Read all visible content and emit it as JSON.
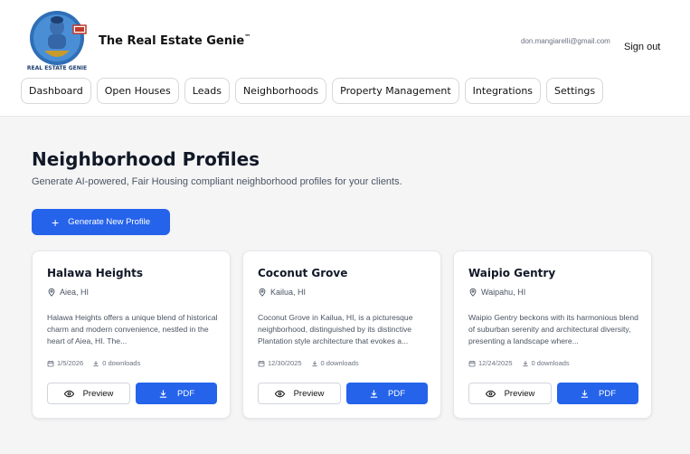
{
  "header": {
    "brand": "The Real Estate Genie",
    "brand_mark": "™",
    "logo_icon": "genie-logo-icon",
    "logo_text": "REAL ESTATE GENIE",
    "user_email": "don.mangiarelli@gmail.com",
    "sign_out": "Sign out"
  },
  "nav": [
    {
      "label": "Dashboard"
    },
    {
      "label": "Open Houses"
    },
    {
      "label": "Leads"
    },
    {
      "label": "Neighborhoods"
    },
    {
      "label": "Property Management"
    },
    {
      "label": "Integrations"
    },
    {
      "label": "Settings"
    }
  ],
  "page": {
    "title": "Neighborhood Profiles",
    "subtitle": "Generate AI-powered, Fair Housing compliant neighborhood profiles for your clients.",
    "generate_button": "Generate New Profile",
    "generate_icon": "plus-icon"
  },
  "cards": [
    {
      "name": "Halawa Heights",
      "location": "Aiea, HI",
      "description": "Halawa Heights offers a unique blend of historical charm and modern convenience, nestled in the heart of Aiea, HI. The...",
      "date": "1/5/2026",
      "downloads": "0 downloads",
      "preview_label": "Preview",
      "pdf_label": "PDF"
    },
    {
      "name": "Coconut Grove",
      "location": "Kailua, HI",
      "description": "Coconut Grove in Kailua, HI, is a picturesque neighborhood, distinguished by its distinctive Plantation style architecture that evokes a...",
      "date": "12/30/2025",
      "downloads": "0 downloads",
      "preview_label": "Preview",
      "pdf_label": "PDF"
    },
    {
      "name": "Waipio Gentry",
      "location": "Waipahu, HI",
      "description": "Waipio Gentry beckons with its harmonious blend of suburban serenity and architectural diversity, presenting a landscape where...",
      "date": "12/24/2025",
      "downloads": "0 downloads",
      "preview_label": "Preview",
      "pdf_label": "PDF"
    }
  ],
  "colors": {
    "accent": "#2563eb",
    "background": "#f5f5f6",
    "card": "#ffffff"
  }
}
